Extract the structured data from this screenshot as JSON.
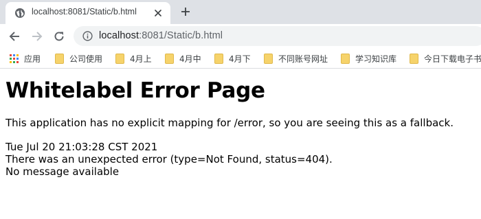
{
  "tab": {
    "title": "localhost:8081/Static/b.html",
    "favicon": "globe-icon",
    "close_icon": "close-icon"
  },
  "toolbar": {
    "url_host": "localhost",
    "url_path": ":8081/Static/b.html",
    "back_icon": "arrow-left-icon",
    "forward_icon": "arrow-right-icon",
    "reload_icon": "reload-icon",
    "site_info_icon": "info-circle-icon"
  },
  "bookmarks": {
    "apps_label": "应用",
    "items": [
      {
        "label": "公司使用"
      },
      {
        "label": "4月上"
      },
      {
        "label": "4月中"
      },
      {
        "label": "4月下"
      },
      {
        "label": "不同账号网址"
      },
      {
        "label": "学习知识库"
      },
      {
        "label": "今日下载电子书"
      }
    ]
  },
  "page": {
    "heading": "Whitelabel Error Page",
    "description": "This application has no explicit mapping for /error, so you are seeing this as a fallback.",
    "timestamp": "Tue Jul 20 21:03:28 CST 2021",
    "error_line": "There was an unexpected error (type=Not Found, status=404).",
    "message_line": "No message available"
  },
  "colors": {
    "tabstrip_bg": "#dee1e6",
    "omnibox_bg": "#f1f3f4",
    "folder": "#f6d36b"
  }
}
